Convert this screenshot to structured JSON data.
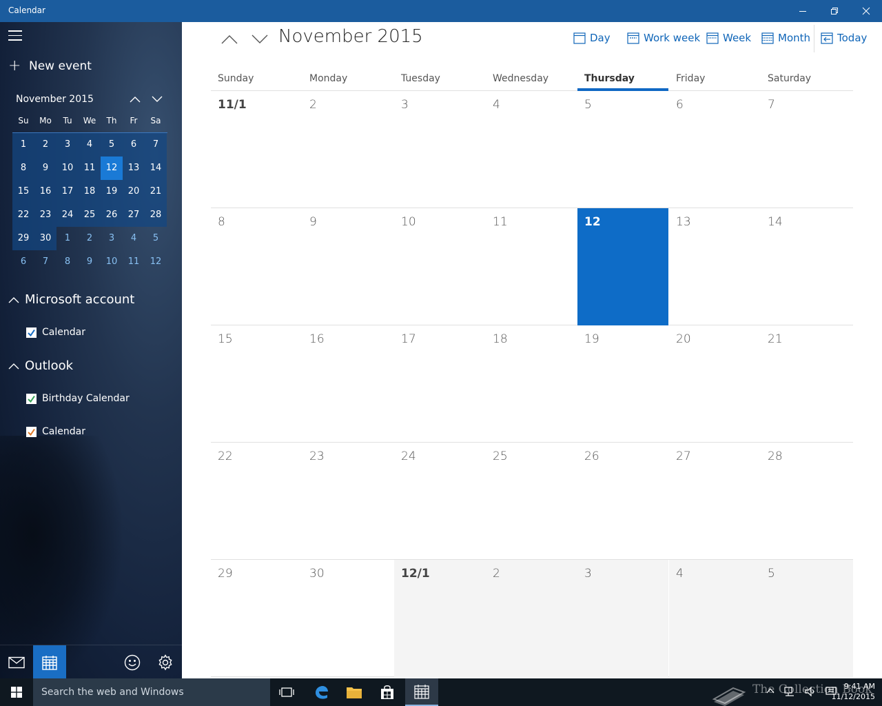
{
  "window": {
    "title": "Calendar"
  },
  "sidebar": {
    "new_event_label": "New event",
    "mini_calendar": {
      "month_label": "November 2015",
      "weekdays": [
        "Su",
        "Mo",
        "Tu",
        "We",
        "Th",
        "Fr",
        "Sa"
      ],
      "days": [
        [
          "1",
          "2",
          "3",
          "4",
          "5",
          "6",
          "7"
        ],
        [
          "8",
          "9",
          "10",
          "11",
          "12",
          "13",
          "14"
        ],
        [
          "15",
          "16",
          "17",
          "18",
          "19",
          "20",
          "21"
        ],
        [
          "22",
          "23",
          "24",
          "25",
          "26",
          "27",
          "28"
        ],
        [
          "29",
          "30",
          "1",
          "2",
          "3",
          "4",
          "5"
        ],
        [
          "6",
          "7",
          "8",
          "9",
          "10",
          "11",
          "12"
        ]
      ],
      "today": "12"
    },
    "accounts": [
      {
        "name": "Microsoft account",
        "calendars": [
          {
            "label": "Calendar",
            "color": "#1a6ec4",
            "checked": true
          }
        ]
      },
      {
        "name": "Outlook",
        "calendars": [
          {
            "label": "Birthday Calendar",
            "color": "#3aa55a",
            "checked": true
          },
          {
            "label": "Calendar",
            "color": "#e07b2a",
            "checked": true
          }
        ]
      }
    ],
    "bottom_icons": [
      "mail-icon",
      "calendar-icon",
      "feedback-smiley-icon",
      "settings-gear-icon"
    ]
  },
  "main": {
    "month_title": "November 2015",
    "views": {
      "day": "Day",
      "work_week": "Work week",
      "week": "Week",
      "month": "Month",
      "today": "Today"
    },
    "selected_view": "Month",
    "weekdays": [
      "Sunday",
      "Monday",
      "Tuesday",
      "Wednesday",
      "Thursday",
      "Friday",
      "Saturday"
    ],
    "selected_weekday": "Thursday",
    "weeks": [
      [
        "11/1",
        "2",
        "3",
        "4",
        "5",
        "6",
        "7"
      ],
      [
        "8",
        "9",
        "10",
        "11",
        "12",
        "13",
        "14"
      ],
      [
        "15",
        "16",
        "17",
        "18",
        "19",
        "20",
        "21"
      ],
      [
        "22",
        "23",
        "24",
        "25",
        "26",
        "27",
        "28"
      ],
      [
        "29",
        "30",
        "12/1",
        "2",
        "3",
        "4",
        "5"
      ]
    ],
    "today": "12"
  },
  "taskbar": {
    "search_placeholder": "Search the web and Windows",
    "time": "9:41 AM",
    "date": "11/12/2015",
    "watermark": "The Collection Book"
  },
  "colors": {
    "accent": "#0e6cc7",
    "titlebar": "#1b5c9e"
  }
}
